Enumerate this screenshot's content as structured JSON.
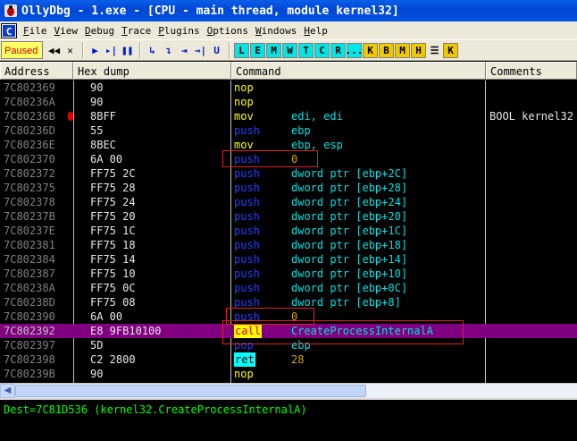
{
  "window": {
    "title": "OllyDbg - 1.exe - [CPU - main thread, module kernel32]"
  },
  "menu": {
    "cpu_button": "C",
    "items": [
      "File",
      "View",
      "Debug",
      "Trace",
      "Plugins",
      "Options",
      "Windows",
      "Help"
    ]
  },
  "toolbar": {
    "status": "Paused",
    "status_color": "#ffff66",
    "nav_icons": [
      "rewind-icon",
      "close-icon"
    ],
    "run_icons": [
      "run-icon",
      "step-into-icon",
      "pause-icon",
      "step-over-icon",
      "animate-into-icon",
      "animate-over-icon",
      "execute-till-return-icon",
      "execute-till-user-code-icon"
    ],
    "letter_buttons": [
      "L",
      "E",
      "M",
      "W",
      "T",
      "C",
      "R",
      "...",
      "K",
      "B",
      "M",
      "H"
    ],
    "extra_buttons": [
      "K"
    ]
  },
  "columns": {
    "address": "Address",
    "hex": "Hex dump",
    "command": "Command",
    "comments": "Comments"
  },
  "rows": [
    {
      "addr": "7C802369",
      "hex": "90",
      "mnem": "nop",
      "ops": "",
      "cmt": ""
    },
    {
      "addr": "7C80236A",
      "hex": "90",
      "mnem": "nop",
      "ops": "",
      "cmt": ""
    },
    {
      "addr": "7C80236B",
      "hex": "8BFF",
      "mnem": "mov",
      "ops": "edi, edi",
      "cmt": "BOOL kernel32"
    },
    {
      "addr": "7C80236D",
      "hex": "55",
      "mnem": "push",
      "ops": "ebp",
      "cmt": ""
    },
    {
      "addr": "7C80236E",
      "hex": "8BEC",
      "mnem": "mov",
      "ops": "ebp, esp",
      "cmt": ""
    },
    {
      "addr": "7C802370",
      "hex": "6A 00",
      "mnem": "push",
      "ops": "0",
      "cmt": ""
    },
    {
      "addr": "7C802372",
      "hex": "FF75 2C",
      "mnem": "push",
      "ops": "dword ptr [ebp+2C]",
      "cmt": ""
    },
    {
      "addr": "7C802375",
      "hex": "FF75 28",
      "mnem": "push",
      "ops": "dword ptr [ebp+28]",
      "cmt": ""
    },
    {
      "addr": "7C802378",
      "hex": "FF75 24",
      "mnem": "push",
      "ops": "dword ptr [ebp+24]",
      "cmt": ""
    },
    {
      "addr": "7C80237B",
      "hex": "FF75 20",
      "mnem": "push",
      "ops": "dword ptr [ebp+20]",
      "cmt": ""
    },
    {
      "addr": "7C80237E",
      "hex": "FF75 1C",
      "mnem": "push",
      "ops": "dword ptr [ebp+1C]",
      "cmt": ""
    },
    {
      "addr": "7C802381",
      "hex": "FF75 18",
      "mnem": "push",
      "ops": "dword ptr [ebp+18]",
      "cmt": ""
    },
    {
      "addr": "7C802384",
      "hex": "FF75 14",
      "mnem": "push",
      "ops": "dword ptr [ebp+14]",
      "cmt": ""
    },
    {
      "addr": "7C802387",
      "hex": "FF75 10",
      "mnem": "push",
      "ops": "dword ptr [ebp+10]",
      "cmt": ""
    },
    {
      "addr": "7C80238A",
      "hex": "FF75 0C",
      "mnem": "push",
      "ops": "dword ptr [ebp+0C]",
      "cmt": ""
    },
    {
      "addr": "7C80238D",
      "hex": "FF75 08",
      "mnem": "push",
      "ops": "dword ptr [ebp+8]",
      "cmt": ""
    },
    {
      "addr": "7C802390",
      "hex": "6A 00",
      "mnem": "push",
      "ops": "0",
      "cmt": ""
    },
    {
      "addr": "7C802392",
      "hex": "E8 9FB10100",
      "mnem": "call",
      "ops": "CreateProcessInternalA",
      "cmt": ""
    },
    {
      "addr": "7C802397",
      "hex": "5D",
      "mnem": "pop",
      "ops": "ebp",
      "cmt": ""
    },
    {
      "addr": "7C802398",
      "hex": "C2 2800",
      "mnem": "ret",
      "ops": "28",
      "cmt": ""
    },
    {
      "addr": "7C80239B",
      "hex": "90",
      "mnem": "nop",
      "ops": "",
      "cmt": ""
    }
  ],
  "selected_row_addr": "7C802392",
  "breakpoint_addr": "7C80236B",
  "info_pane": {
    "text": "Dest=7C81D536 (kernel32.CreateProcessInternalA)"
  }
}
